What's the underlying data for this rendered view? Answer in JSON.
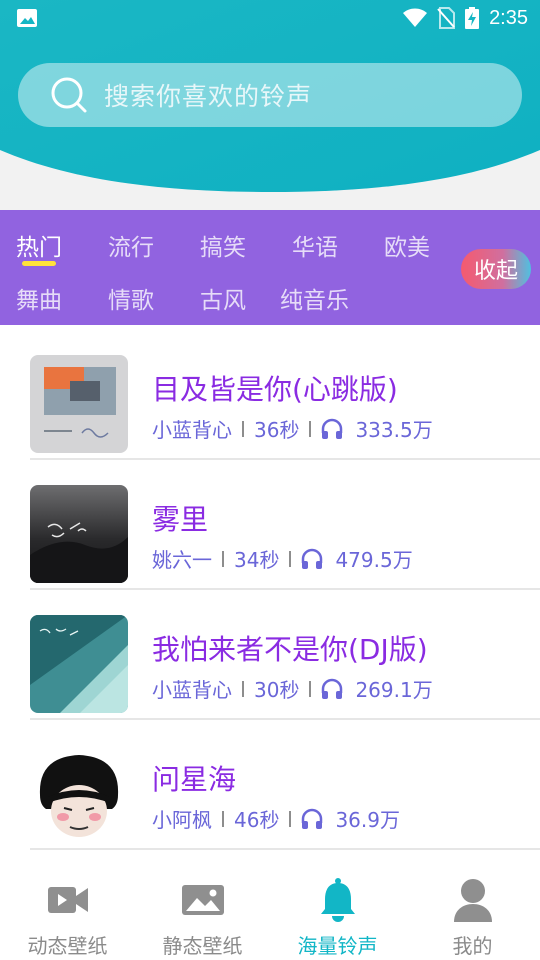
{
  "status_bar": {
    "time": "2:35"
  },
  "search": {
    "placeholder": "搜索你喜欢的铃声"
  },
  "categories": {
    "row1": [
      "热门",
      "流行",
      "搞笑",
      "华语",
      "欧美"
    ],
    "row2": [
      "舞曲",
      "情歌",
      "古风",
      "纯音乐"
    ],
    "active": "热门",
    "collapse_label": "收起"
  },
  "ringtones": [
    {
      "title": "目及皆是你(心跳版)",
      "artist": "小蓝背心",
      "duration": "36秒",
      "plays": "333.5万"
    },
    {
      "title": "雾里",
      "artist": "姚六一",
      "duration": "34秒",
      "plays": "479.5万"
    },
    {
      "title": "我怕来者不是你(DJ版)",
      "artist": "小蓝背心",
      "duration": "30秒",
      "plays": "269.1万"
    },
    {
      "title": "问星海",
      "artist": "小阿枫",
      "duration": "46秒",
      "plays": "36.9万"
    }
  ],
  "bottom_nav": {
    "items": [
      {
        "label": "动态壁纸",
        "icon": "video-icon"
      },
      {
        "label": "静态壁纸",
        "icon": "image-icon"
      },
      {
        "label": "海量铃声",
        "icon": "bell-icon"
      },
      {
        "label": "我的",
        "icon": "person-icon"
      }
    ],
    "active_index": 2
  },
  "colors": {
    "header_teal": "#14b6c4",
    "category_purple": "#9163e0",
    "title_purple": "#8a2be2",
    "meta_blue": "#6a66d8",
    "active_tab": "#12b6c6",
    "underline_yellow": "#ffe23a"
  }
}
